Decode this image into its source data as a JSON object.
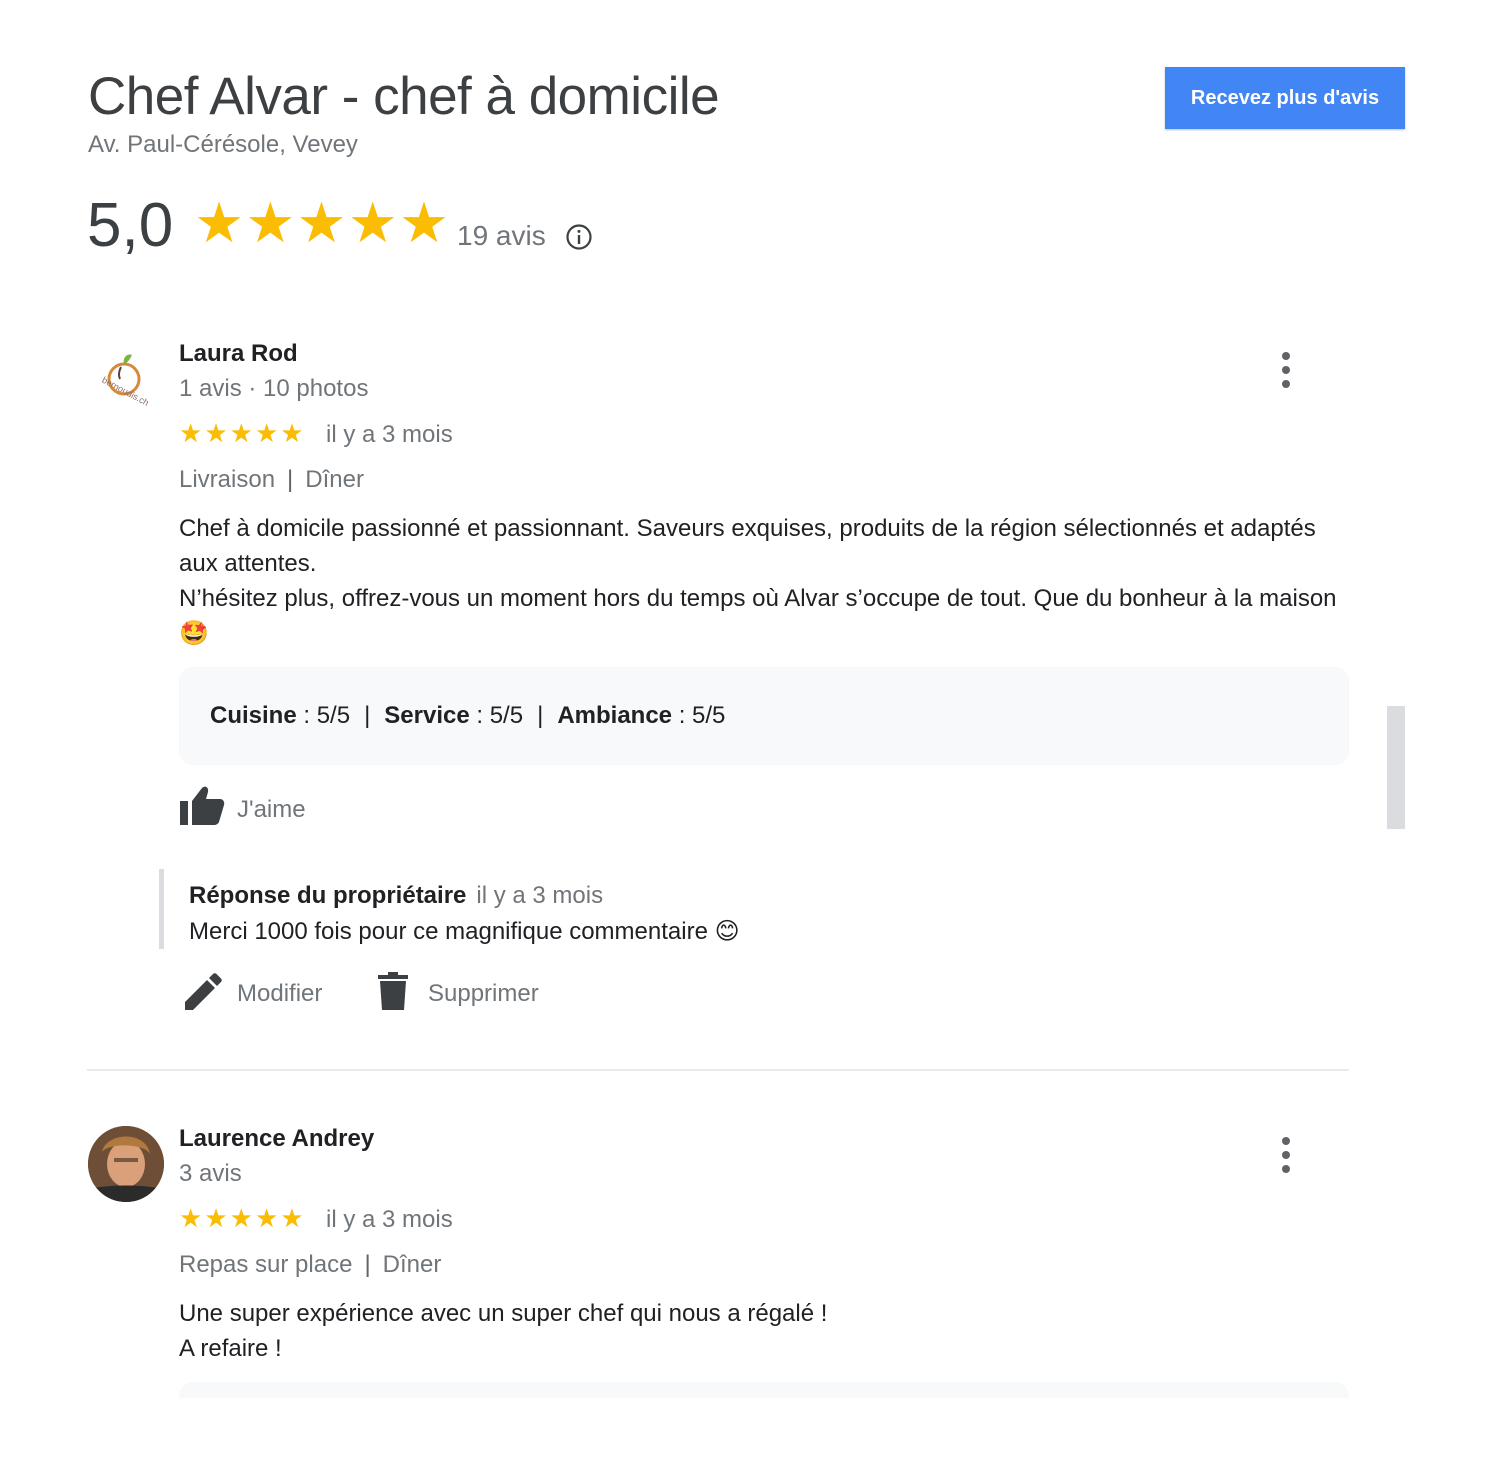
{
  "header": {
    "title": "Chef Alvar - chef à domicile",
    "address": "Av. Paul-Cérésole, Vevey",
    "cta_label": "Recevez plus d'avis",
    "cta_color": "#4285f4"
  },
  "summary": {
    "score": "5,0",
    "star_rating": 5,
    "star_color": "#fbbc04",
    "review_count": "19 avis",
    "info_icon": "info-icon"
  },
  "reviews": [
    {
      "author": "Laura Rod",
      "author_meta": "1 avis · 10 photos",
      "avatar_text": "bernoudis.ch",
      "stars": 5,
      "time": "il y a 3 mois",
      "tag1": "Livraison",
      "tag_sep": "|",
      "tag2": "Dîner",
      "text_line1": "Chef à domicile passionné et passionnant. Saveurs exquises, produits de la région sélectionnés et adaptés aux attentes.",
      "text_line2": "N’hésitez plus, offrez-vous un moment hors du temps où Alvar s’occupe de tout. Que du bonheur à la maison 🤩",
      "ratings": {
        "cuisine_label": "Cuisine",
        "cuisine_value": ": 5/5",
        "service_label": "Service",
        "service_value": ": 5/5",
        "ambiance_label": "Ambiance",
        "ambiance_value": ": 5/5",
        "sep": "|"
      },
      "like_label": "J'aime",
      "reply": {
        "heading": "Réponse du propriétaire",
        "time": "il y a 3 mois",
        "text": "Merci 1000 fois pour ce magnifique commentaire 😊"
      },
      "edit_label": "Modifier",
      "delete_label": "Supprimer"
    },
    {
      "author": "Laurence Andrey",
      "author_meta": "3 avis",
      "stars": 5,
      "time": "il y a 3 mois",
      "tag1": "Repas sur place",
      "tag_sep": "|",
      "tag2": "Dîner",
      "text_line1": "Une super expérience avec un super chef qui nous a régalé !",
      "text_line2": "A refaire !"
    }
  ]
}
